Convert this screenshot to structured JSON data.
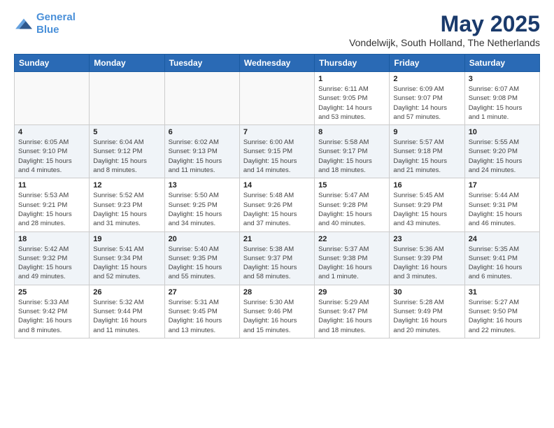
{
  "header": {
    "logo_line1": "General",
    "logo_line2": "Blue",
    "month_title": "May 2025",
    "location": "Vondelwijk, South Holland, The Netherlands"
  },
  "weekdays": [
    "Sunday",
    "Monday",
    "Tuesday",
    "Wednesday",
    "Thursday",
    "Friday",
    "Saturday"
  ],
  "weeks": [
    [
      {
        "day": "",
        "info": ""
      },
      {
        "day": "",
        "info": ""
      },
      {
        "day": "",
        "info": ""
      },
      {
        "day": "",
        "info": ""
      },
      {
        "day": "1",
        "info": "Sunrise: 6:11 AM\nSunset: 9:05 PM\nDaylight: 14 hours\nand 53 minutes."
      },
      {
        "day": "2",
        "info": "Sunrise: 6:09 AM\nSunset: 9:07 PM\nDaylight: 14 hours\nand 57 minutes."
      },
      {
        "day": "3",
        "info": "Sunrise: 6:07 AM\nSunset: 9:08 PM\nDaylight: 15 hours\nand 1 minute."
      }
    ],
    [
      {
        "day": "4",
        "info": "Sunrise: 6:05 AM\nSunset: 9:10 PM\nDaylight: 15 hours\nand 4 minutes."
      },
      {
        "day": "5",
        "info": "Sunrise: 6:04 AM\nSunset: 9:12 PM\nDaylight: 15 hours\nand 8 minutes."
      },
      {
        "day": "6",
        "info": "Sunrise: 6:02 AM\nSunset: 9:13 PM\nDaylight: 15 hours\nand 11 minutes."
      },
      {
        "day": "7",
        "info": "Sunrise: 6:00 AM\nSunset: 9:15 PM\nDaylight: 15 hours\nand 14 minutes."
      },
      {
        "day": "8",
        "info": "Sunrise: 5:58 AM\nSunset: 9:17 PM\nDaylight: 15 hours\nand 18 minutes."
      },
      {
        "day": "9",
        "info": "Sunrise: 5:57 AM\nSunset: 9:18 PM\nDaylight: 15 hours\nand 21 minutes."
      },
      {
        "day": "10",
        "info": "Sunrise: 5:55 AM\nSunset: 9:20 PM\nDaylight: 15 hours\nand 24 minutes."
      }
    ],
    [
      {
        "day": "11",
        "info": "Sunrise: 5:53 AM\nSunset: 9:21 PM\nDaylight: 15 hours\nand 28 minutes."
      },
      {
        "day": "12",
        "info": "Sunrise: 5:52 AM\nSunset: 9:23 PM\nDaylight: 15 hours\nand 31 minutes."
      },
      {
        "day": "13",
        "info": "Sunrise: 5:50 AM\nSunset: 9:25 PM\nDaylight: 15 hours\nand 34 minutes."
      },
      {
        "day": "14",
        "info": "Sunrise: 5:48 AM\nSunset: 9:26 PM\nDaylight: 15 hours\nand 37 minutes."
      },
      {
        "day": "15",
        "info": "Sunrise: 5:47 AM\nSunset: 9:28 PM\nDaylight: 15 hours\nand 40 minutes."
      },
      {
        "day": "16",
        "info": "Sunrise: 5:45 AM\nSunset: 9:29 PM\nDaylight: 15 hours\nand 43 minutes."
      },
      {
        "day": "17",
        "info": "Sunrise: 5:44 AM\nSunset: 9:31 PM\nDaylight: 15 hours\nand 46 minutes."
      }
    ],
    [
      {
        "day": "18",
        "info": "Sunrise: 5:42 AM\nSunset: 9:32 PM\nDaylight: 15 hours\nand 49 minutes."
      },
      {
        "day": "19",
        "info": "Sunrise: 5:41 AM\nSunset: 9:34 PM\nDaylight: 15 hours\nand 52 minutes."
      },
      {
        "day": "20",
        "info": "Sunrise: 5:40 AM\nSunset: 9:35 PM\nDaylight: 15 hours\nand 55 minutes."
      },
      {
        "day": "21",
        "info": "Sunrise: 5:38 AM\nSunset: 9:37 PM\nDaylight: 15 hours\nand 58 minutes."
      },
      {
        "day": "22",
        "info": "Sunrise: 5:37 AM\nSunset: 9:38 PM\nDaylight: 16 hours\nand 1 minute."
      },
      {
        "day": "23",
        "info": "Sunrise: 5:36 AM\nSunset: 9:39 PM\nDaylight: 16 hours\nand 3 minutes."
      },
      {
        "day": "24",
        "info": "Sunrise: 5:35 AM\nSunset: 9:41 PM\nDaylight: 16 hours\nand 6 minutes."
      }
    ],
    [
      {
        "day": "25",
        "info": "Sunrise: 5:33 AM\nSunset: 9:42 PM\nDaylight: 16 hours\nand 8 minutes."
      },
      {
        "day": "26",
        "info": "Sunrise: 5:32 AM\nSunset: 9:44 PM\nDaylight: 16 hours\nand 11 minutes."
      },
      {
        "day": "27",
        "info": "Sunrise: 5:31 AM\nSunset: 9:45 PM\nDaylight: 16 hours\nand 13 minutes."
      },
      {
        "day": "28",
        "info": "Sunrise: 5:30 AM\nSunset: 9:46 PM\nDaylight: 16 hours\nand 15 minutes."
      },
      {
        "day": "29",
        "info": "Sunrise: 5:29 AM\nSunset: 9:47 PM\nDaylight: 16 hours\nand 18 minutes."
      },
      {
        "day": "30",
        "info": "Sunrise: 5:28 AM\nSunset: 9:49 PM\nDaylight: 16 hours\nand 20 minutes."
      },
      {
        "day": "31",
        "info": "Sunrise: 5:27 AM\nSunset: 9:50 PM\nDaylight: 16 hours\nand 22 minutes."
      }
    ]
  ]
}
